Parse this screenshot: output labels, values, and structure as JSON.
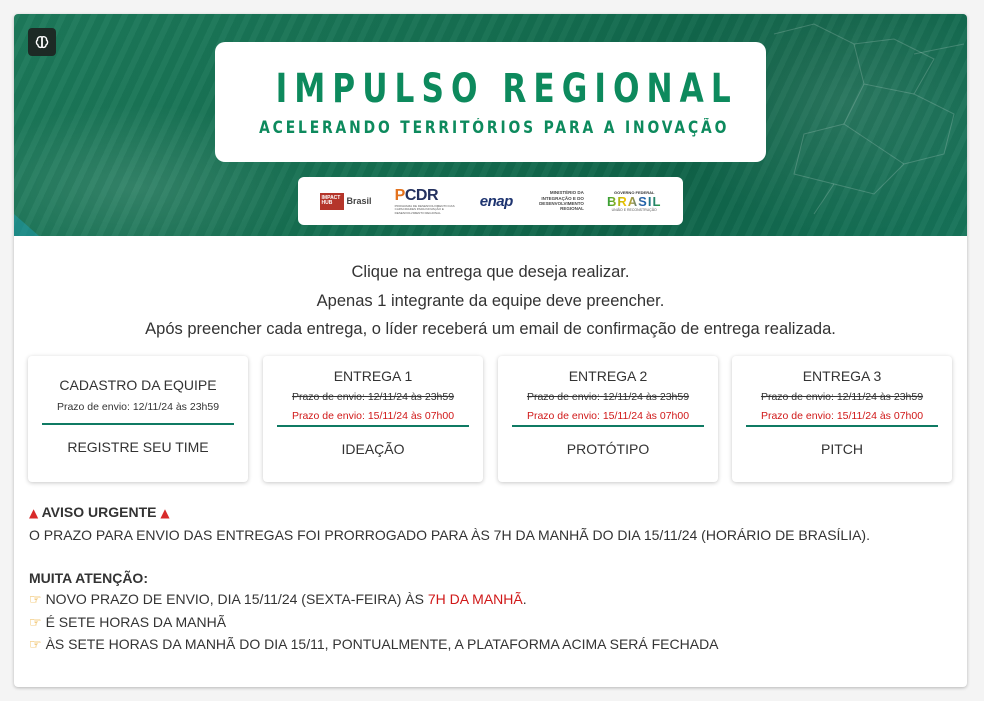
{
  "banner": {
    "title": "IMPULSO REGIONAL",
    "subtitle": "ACELERANDO TERRITÓRIOS PARA A INOVAÇÃO",
    "logos": {
      "impact_box": "IMPACT HUB",
      "impact_text": "Brasil",
      "pcdr_left": "P",
      "pcdr_right": "CDR",
      "pcdr_small": "PROGRAMA DE DESENVOLVIMENTO DAS CAPACIDADES PARA INOVAÇÃO E DESENVOLVIMENTO REGIONAL",
      "enap": "enap",
      "ministry": "MINISTÉRIO DA INTEGRAÇÃO E DO DESENVOLVIMENTO REGIONAL",
      "gov_top": "GOVERNO FEDERAL",
      "gov_main": "BRASIL",
      "gov_bottom": "UNIÃO E RECONSTRUÇÃO"
    }
  },
  "instructions": {
    "line1": "Clique na entrega que deseja realizar.",
    "line2": "Apenas 1 integrante da equipe deve preencher.",
    "line3": "Após preencher cada entrega, o líder receberá um email de confirmação de entrega realizada."
  },
  "cards": {
    "c0": {
      "title": "CADASTRO DA EQUIPE",
      "deadline": "Prazo de envio: 12/11/24 às 23h59",
      "action": "REGISTRE SEU TIME"
    },
    "c1": {
      "title": "ENTREGA 1",
      "old": "Prazo de envio: 12/11/24 às 23h59",
      "new": "Prazo de envio: 15/11/24 às 07h00",
      "action": "IDEAÇÃO"
    },
    "c2": {
      "title": "ENTREGA 2",
      "old": "Prazo de envio: 12/11/24 às 23h59",
      "new": "Prazo de envio: 15/11/24 às 07h00",
      "action": "PROTÓTIPO"
    },
    "c3": {
      "title": "ENTREGA 3",
      "old": "Prazo de envio: 12/11/24 às 23h59",
      "new": "Prazo de envio: 15/11/24 às 07h00",
      "action": "PITCH"
    }
  },
  "notice": {
    "urgent_title": "AVISO URGENTE",
    "urgent_text": "O PRAZO PARA ENVIO DAS ENTREGAS FOI PRORROGADO PARA ÀS 7H DA MANHÃ DO DIA 15/11/24 (HORÁRIO DE BRASÍLIA).",
    "attention_title": "MUITA ATENÇÃO:",
    "item1_pre": "NOVO PRAZO DE ENVIO, DIA 15/11/24 (SEXTA-FEIRA) ÀS ",
    "item1_red": "7H DA MANHÃ",
    "item1_post": ".",
    "item2": "É SETE HORAS DA MANHÃ",
    "item3": "ÀS SETE HORAS DA MANHÃ DO DIA 15/11, PONTUALMENTE, A PLATAFORMA ACIMA SERÁ FECHADA"
  },
  "icons": {
    "brain": "brain-icon",
    "siren": "siren-icon",
    "pointing": "pointing-hand-icon"
  },
  "colors": {
    "brand_green": "#0d8a5d",
    "accent_red": "#d01818",
    "divider": "#0f7a63"
  }
}
